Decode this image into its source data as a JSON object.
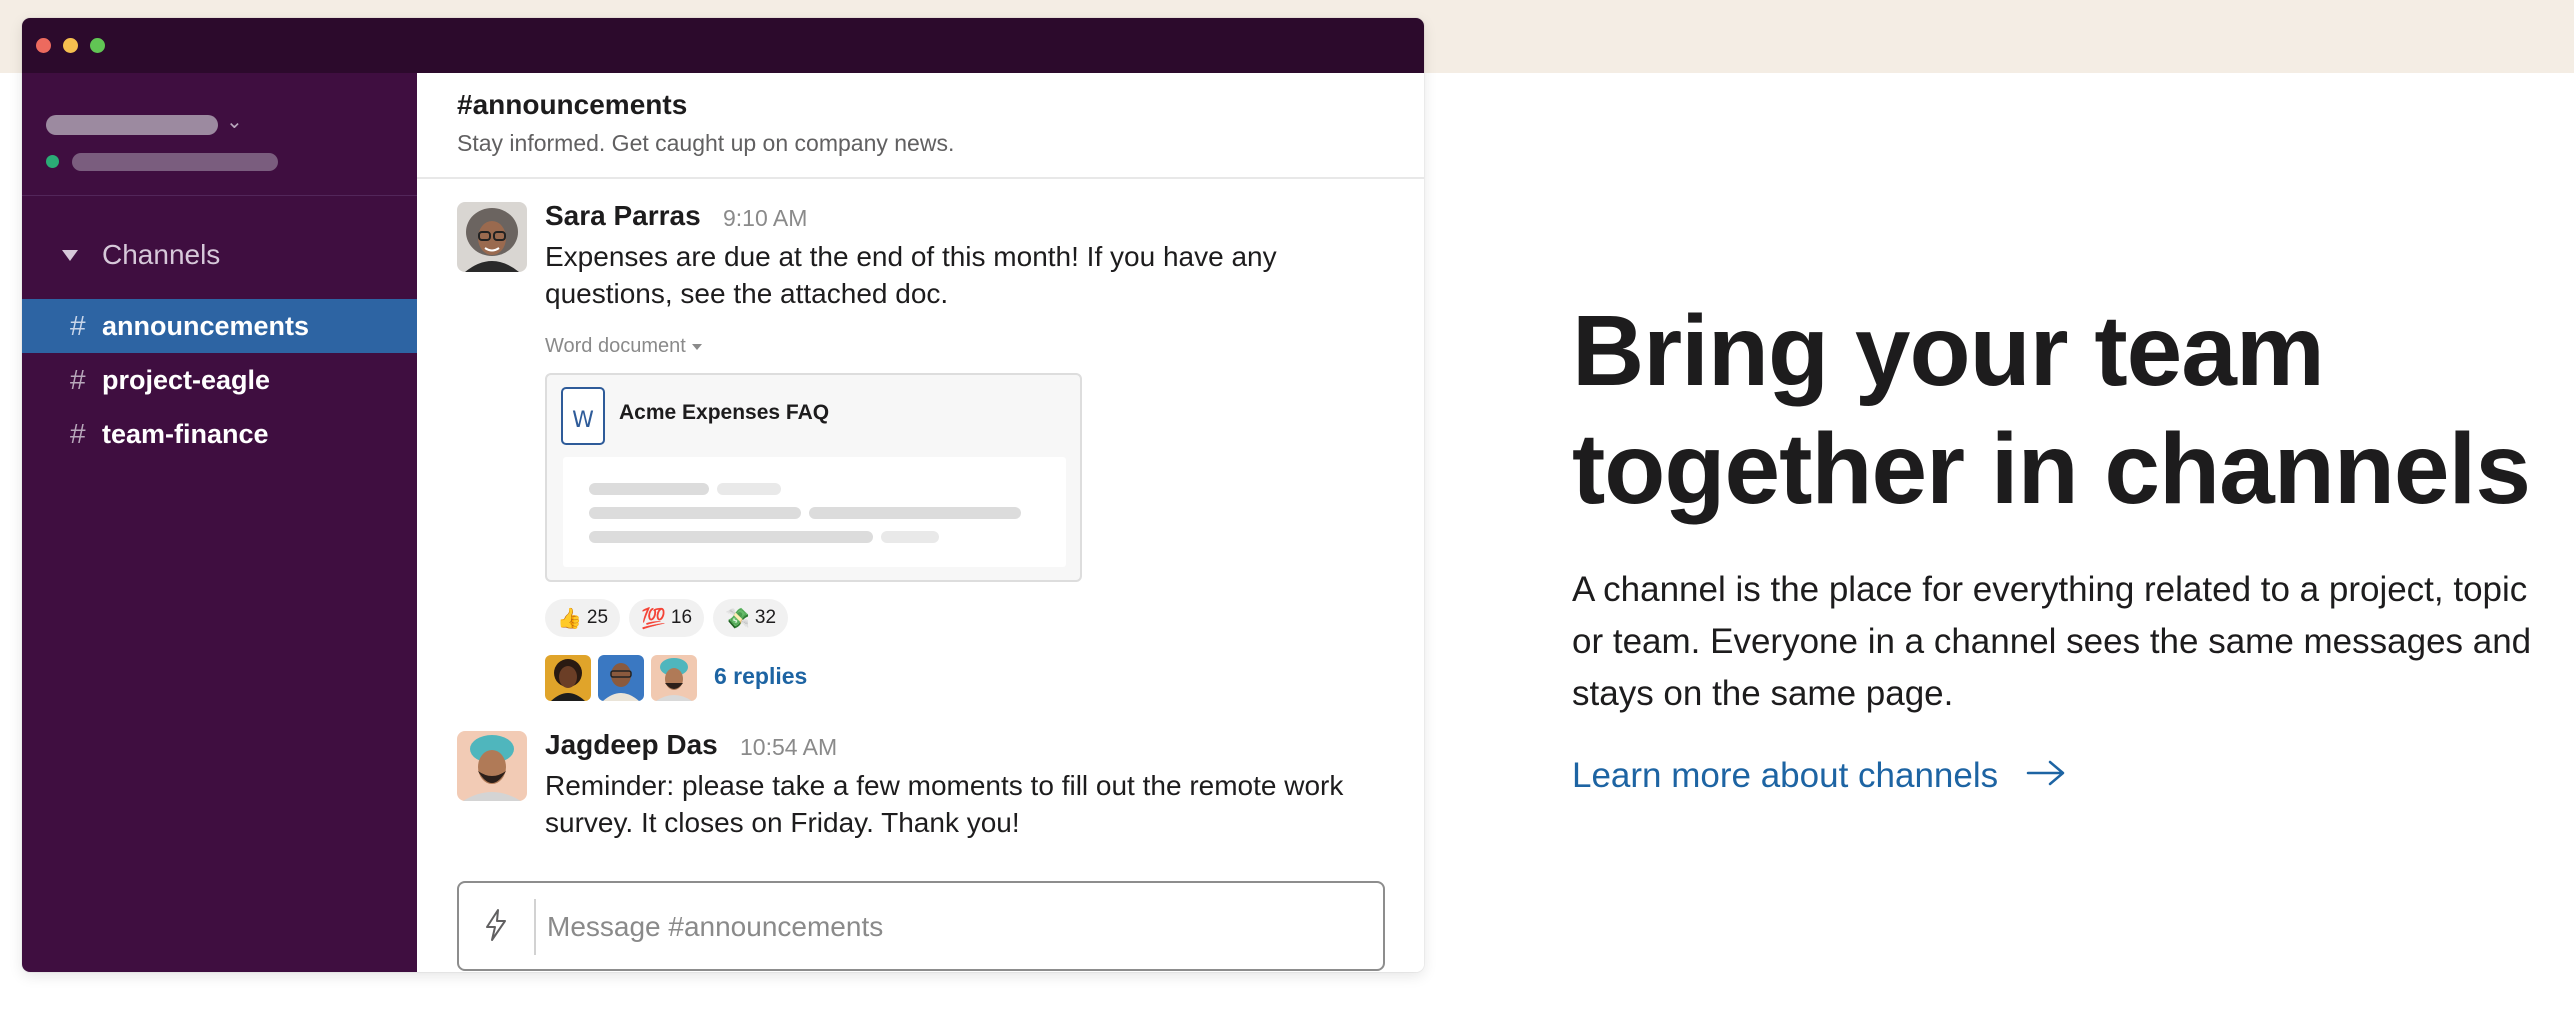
{
  "sidebar": {
    "section_label": "Channels",
    "channels": [
      {
        "label": "announcements",
        "active": true
      },
      {
        "label": "project-eagle",
        "active": false
      },
      {
        "label": "team-finance",
        "active": false
      }
    ]
  },
  "channel": {
    "title": "#announcements",
    "topic": "Stay informed. Get caught up on company news."
  },
  "messages": [
    {
      "author": "Sara Parras",
      "time": "9:10 AM",
      "text": "Expenses are due at the end of this month! If you have any questions, see the attached doc.",
      "file": {
        "type_label": "Word document",
        "name": "Acme Expenses FAQ",
        "icon_letter": "W"
      },
      "reactions": [
        {
          "emoji": "👍",
          "count": "25"
        },
        {
          "emoji": "💯",
          "count": "16"
        },
        {
          "emoji": "💸",
          "count": "32"
        }
      ],
      "replies_label": "6 replies"
    },
    {
      "author": "Jagdeep Das",
      "time": "10:54 AM",
      "text": "Reminder: please take a few moments to fill out the remote work survey. It closes on Friday. Thank you!"
    }
  ],
  "composer": {
    "placeholder": "Message #announcements"
  },
  "marketing": {
    "headline": "Bring your team together in channels",
    "body": "A channel is the place for everything related to a project, topic or team. Everyone in a channel sees the same messages and stays on the same page.",
    "link_label": "Learn more about channels"
  },
  "colors": {
    "sidebar_bg": "#3f0e40",
    "titlebar_bg": "#2c0a2c",
    "active_channel": "#2d64a3",
    "link": "#1d64a3",
    "band": "#f4ede4"
  },
  "icons": {
    "composer": "lightning-bolt-icon",
    "link_arrow": "arrow-right-icon",
    "section_toggle": "caret-down-icon",
    "file": "word-document-icon"
  }
}
